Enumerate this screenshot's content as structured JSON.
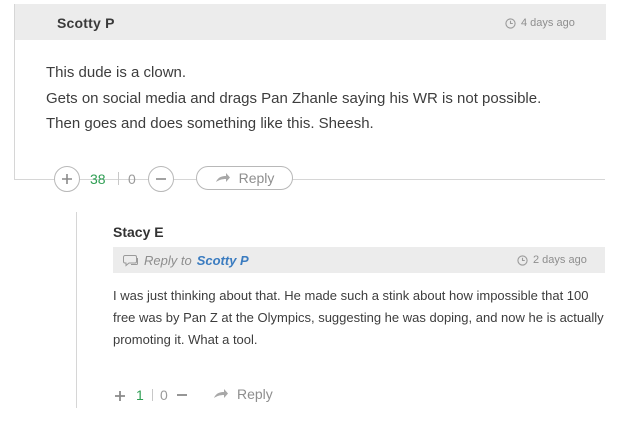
{
  "comment": {
    "author": "Scotty P",
    "timestamp": "4 days ago",
    "body": [
      "This dude is a clown.",
      "Gets on social media and drags Pan Zhanle saying his WR is not possible.",
      "Then goes and does something like this. Sheesh."
    ],
    "upvotes": "38",
    "downvotes": "0",
    "reply_label": "Reply"
  },
  "reply": {
    "author": "Stacy E",
    "reply_to_label": "Reply to",
    "reply_to_author": "Scotty P",
    "timestamp": "2 days ago",
    "body": "I was just thinking about that. He made such a stink about how impossible that 100 free was by Pan Z at the Olympics, suggesting he was doping, and now he is actually promoting it. What a tool.",
    "upvotes": "1",
    "downvotes": "0",
    "reply_label": "Reply"
  },
  "icons": {
    "upvote": "plus-icon",
    "downvote": "minus-icon",
    "timestamp": "clock-icon",
    "reply": "reply-arrow-icon",
    "reply_to": "speech-bubble-icon"
  },
  "colors": {
    "upvote_count": "#2e9e53",
    "reply_to_link": "#3b7cc0",
    "header_bg": "#ececec"
  }
}
